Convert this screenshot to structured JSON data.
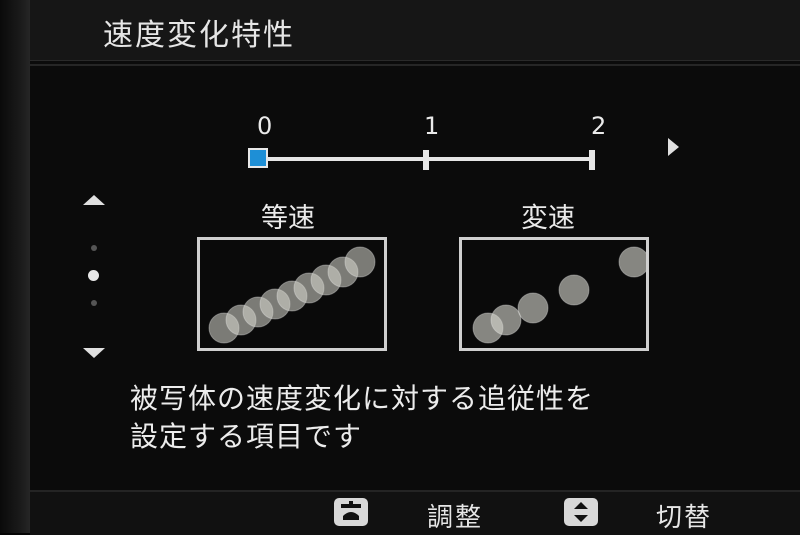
{
  "header": {
    "title": "速度変化特性"
  },
  "slider": {
    "labels": [
      "0",
      "1",
      "2"
    ],
    "selected_value": 0
  },
  "previews": {
    "left_label": "等速",
    "right_label": "変速"
  },
  "description": {
    "line1": "被写体の速度変化に対する追従性を",
    "line2": "設定する項目です"
  },
  "footer": {
    "adjust_label": "調整",
    "switch_label": "切替",
    "adjust_icon": "wheel-icon",
    "switch_icon": "updown-icon"
  },
  "colors": {
    "accent": "#1e8fd6",
    "text": "#e8e8e8",
    "background": "#0b0b0b"
  }
}
